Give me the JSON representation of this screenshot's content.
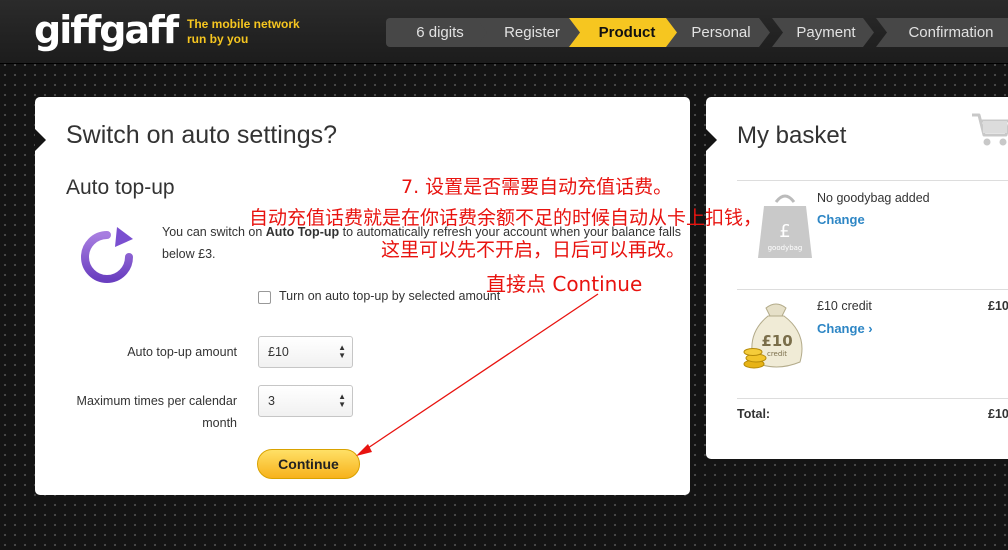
{
  "header": {
    "logo": "giffgaff",
    "tagline": "The mobile network run by you",
    "steps": [
      {
        "label": "6 digits",
        "active": false
      },
      {
        "label": "Register",
        "active": false
      },
      {
        "label": "Product",
        "active": true
      },
      {
        "label": "Personal",
        "active": false
      },
      {
        "label": "Payment",
        "active": false
      },
      {
        "label": "Confirmation",
        "active": false
      }
    ]
  },
  "main": {
    "title": "Switch on auto settings?",
    "section_title": "Auto top-up",
    "description_prefix": "You can switch on ",
    "description_bold": "Auto Top-up",
    "description_suffix": " to automatically refresh your account when your balance falls below £3.",
    "checkbox_label": "Turn on auto top-up by selected amount",
    "checkbox_checked": false,
    "amount_label": "Auto top-up amount",
    "amount_value": "£10",
    "max_label_line1": "Maximum times per calendar",
    "max_label_line2": "month",
    "max_value": "3",
    "continue_label": "Continue"
  },
  "basket": {
    "title": "My basket",
    "items": [
      {
        "name": "No goodybag added",
        "change": "Change",
        "price": "",
        "icon": "goodybag-icon"
      },
      {
        "name": "£10 credit",
        "change": "Change ›",
        "price": "£10",
        "icon": "money-bag-icon"
      }
    ],
    "total_label": "Total:",
    "total_value": "£10",
    "bag_text": "£",
    "bag_subtext": "goodybag",
    "moneybag_text": "£10",
    "moneybag_subtext": "credit"
  },
  "annotations": {
    "line1": "7. 设置是否需要自动充值话费。",
    "line2": "自动充值话费就是在你话费余额不足的时候自动从卡上扣钱，",
    "line3": "这里可以先不开启，日后可以再改。",
    "line4": "直接点 Continue",
    "color": "#e8130f"
  },
  "colors": {
    "brand_yellow": "#f6c620",
    "link_blue": "#2d86c5",
    "annotation_red": "#e8130f"
  }
}
